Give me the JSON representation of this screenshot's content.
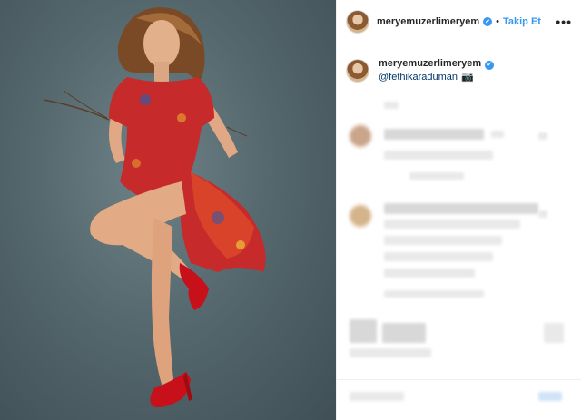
{
  "post": {
    "author": {
      "username": "meryemuzerlimeryem",
      "verified_mark": "✔",
      "follow_label": "Takip Et",
      "separator": "•",
      "more_label": "•••"
    },
    "caption": {
      "username": "meryemuzerlimeryem",
      "mention": "@fethikaraduman",
      "camera_glyph": "📷"
    },
    "colors": {
      "accent": "#3897f0",
      "background_photo": "#55686e",
      "dress_red": "#c62a2a",
      "shoe_red": "#c8101a"
    },
    "icons": [
      "verified-icon",
      "more-options-icon",
      "camera-icon"
    ]
  }
}
